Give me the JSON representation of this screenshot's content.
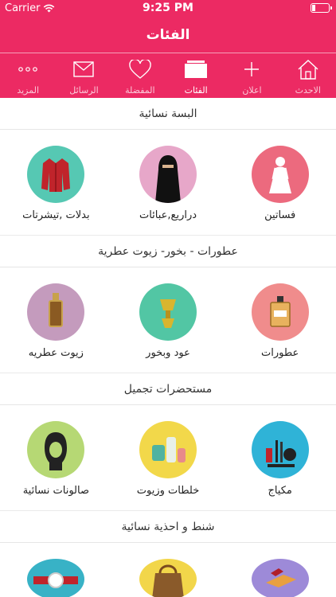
{
  "status_bar": {
    "carrier": "Carrier",
    "time": "9:25 PM"
  },
  "header": {
    "title": "الفئات"
  },
  "tabs": [
    {
      "label": "الاحدث",
      "icon": "home-icon"
    },
    {
      "label": "اعلان",
      "icon": "plus-icon"
    },
    {
      "label": "الفئات",
      "icon": "categories-icon",
      "active": true
    },
    {
      "label": "المفضلة",
      "icon": "heart-icon"
    },
    {
      "label": "الرسائل",
      "icon": "envelope-icon"
    },
    {
      "label": "المزيد",
      "icon": "more-dots-icon"
    }
  ],
  "sections": [
    {
      "title": "البسة نسائية",
      "items": [
        {
          "label": "فساتين",
          "icon": "dress-icon",
          "color": "#ec6a7e"
        },
        {
          "label": "دراريع,عبائات",
          "icon": "abaya-icon",
          "color": "#e7a7c9"
        },
        {
          "label": "بدلات ,تيشرتات",
          "icon": "jacket-icon",
          "color": "#56c8b3"
        }
      ]
    },
    {
      "title": "عطورات - بخور- زيوت عطرية",
      "items": [
        {
          "label": "عطورات",
          "icon": "perfume-bottle-icon",
          "color": "#f08c8c"
        },
        {
          "label": "عود وبخور",
          "icon": "incense-burner-icon",
          "color": "#52c6a4"
        },
        {
          "label": "زيوت عطريه",
          "icon": "oil-bottle-icon",
          "color": "#c49bbd"
        }
      ]
    },
    {
      "title": "مستحضرات تجميل",
      "items": [
        {
          "label": "مكياج",
          "icon": "makeup-icon",
          "color": "#2fb3d7"
        },
        {
          "label": "خلطات وزيوت",
          "icon": "cosmetic-jars-icon",
          "color": "#f2d84a"
        },
        {
          "label": "صالونات نسائية",
          "icon": "salon-woman-icon",
          "color": "#b6d874"
        }
      ]
    },
    {
      "title": "شنط و احذية نسائية",
      "items": [
        {
          "label": "",
          "icon": "shoes-box-icon",
          "color": "#9d8ad8"
        },
        {
          "label": "",
          "icon": "handbag-icon",
          "color": "#f2d64a"
        },
        {
          "label": "",
          "icon": "watch-icon",
          "color": "#38b2c6"
        }
      ]
    }
  ]
}
